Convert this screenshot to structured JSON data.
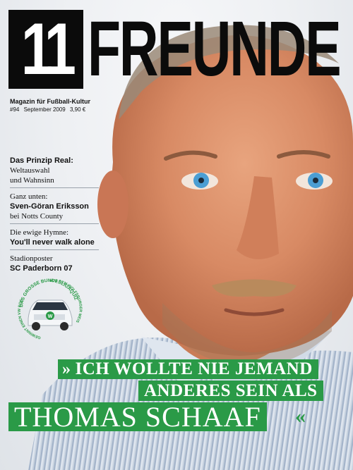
{
  "masthead": {
    "logo_number": "11",
    "logo_word": "FREUNDE",
    "tagline": "Magazin für Fußball-Kultur",
    "issue": "#94",
    "date": "September 2009",
    "price": "3,90 €"
  },
  "teasers": [
    {
      "line1": "Das Prinzip Real:",
      "line1_style": "bold",
      "line2": "Weltauswahl",
      "line3": "und Wahnsinn",
      "rest_style": "regular"
    },
    {
      "line1": "Ganz unten:",
      "line1_style": "regular",
      "line2": "Sven-Göran Eriksson",
      "line2_style": "bold",
      "line3": "bei Notts County"
    },
    {
      "line1": "Die ewige Hymne:",
      "line1_style": "regular",
      "line2": "You'll never walk alone",
      "line2_style": "bold"
    },
    {
      "line1": "Stadionposter",
      "line1_style": "regular",
      "line2": "SC Paderborn 07",
      "line2_style": "bold"
    }
  ],
  "promo": {
    "ring_text_top": "DAS GROSSE BUNDESLIGAQUIZ",
    "ring_text_mid": "AUS DEM WOLFSBURGER MEISTERKORSO",
    "ring_text_left": "GEWINNT EINEN VW EOS",
    "car_badge": "W"
  },
  "headline": {
    "open_quote": "»",
    "line1": "ICH WOLLTE NIE JEMAND",
    "line2": "ANDERES SEIN ALS",
    "line3": "THOMAS SCHAAF",
    "close_quote": "«"
  },
  "colors": {
    "brand_green": "#2a9a47",
    "logo_black": "#0b0b0b"
  }
}
